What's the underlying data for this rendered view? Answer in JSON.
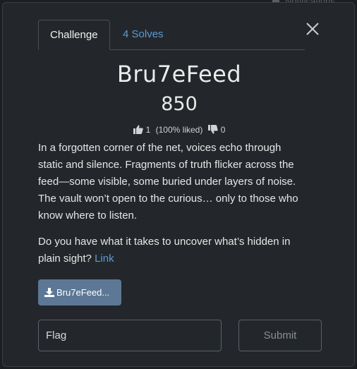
{
  "background": {
    "notifications_label": "Notifications"
  },
  "tabs": [
    {
      "label": "Challenge"
    },
    {
      "label": "4 Solves"
    }
  ],
  "challenge": {
    "title": "Bru7eFeed",
    "points": "850",
    "likes": "1",
    "liked_pct": "(100% liked)",
    "dislikes": "0",
    "description_p1": "In a forgotten corner of the net, voices echo through static and silence. Fragments of truth flicker across the feed—some visible, some buried under layers of noise. The vault won’t open to the curious… only to those who know where to listen.",
    "description_p2": "Do you have what it takes to uncover what’s hidden in plain sight?",
    "link_label": "Link",
    "file_label": "Bru7eFeed..."
  },
  "form": {
    "flag_placeholder": "Flag",
    "submit_label": "Submit"
  },
  "colors": {
    "accent_link": "#5b9bd5",
    "file_button": "#5c7896",
    "modal_bg": "#23272b"
  },
  "icons": {
    "close": "close-icon",
    "thumbs_up": "thumbs-up-icon",
    "thumbs_down": "thumbs-down-icon",
    "download": "download-icon"
  }
}
